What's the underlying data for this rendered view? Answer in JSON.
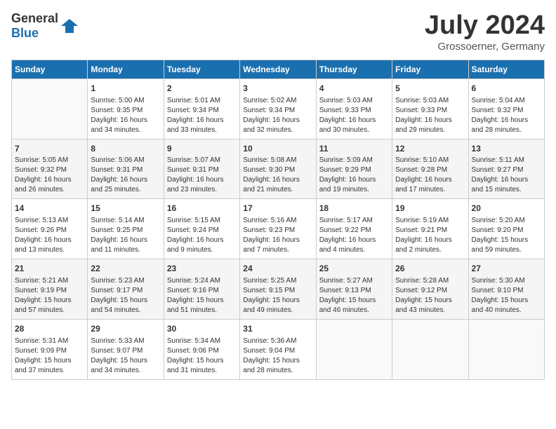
{
  "header": {
    "logo_general": "General",
    "logo_blue": "Blue",
    "month": "July 2024",
    "location": "Grossoerner, Germany"
  },
  "weekdays": [
    "Sunday",
    "Monday",
    "Tuesday",
    "Wednesday",
    "Thursday",
    "Friday",
    "Saturday"
  ],
  "weeks": [
    [
      {
        "day": "",
        "info": ""
      },
      {
        "day": "1",
        "info": "Sunrise: 5:00 AM\nSunset: 9:35 PM\nDaylight: 16 hours\nand 34 minutes."
      },
      {
        "day": "2",
        "info": "Sunrise: 5:01 AM\nSunset: 9:34 PM\nDaylight: 16 hours\nand 33 minutes."
      },
      {
        "day": "3",
        "info": "Sunrise: 5:02 AM\nSunset: 9:34 PM\nDaylight: 16 hours\nand 32 minutes."
      },
      {
        "day": "4",
        "info": "Sunrise: 5:03 AM\nSunset: 9:33 PM\nDaylight: 16 hours\nand 30 minutes."
      },
      {
        "day": "5",
        "info": "Sunrise: 5:03 AM\nSunset: 9:33 PM\nDaylight: 16 hours\nand 29 minutes."
      },
      {
        "day": "6",
        "info": "Sunrise: 5:04 AM\nSunset: 9:32 PM\nDaylight: 16 hours\nand 28 minutes."
      }
    ],
    [
      {
        "day": "7",
        "info": "Sunrise: 5:05 AM\nSunset: 9:32 PM\nDaylight: 16 hours\nand 26 minutes."
      },
      {
        "day": "8",
        "info": "Sunrise: 5:06 AM\nSunset: 9:31 PM\nDaylight: 16 hours\nand 25 minutes."
      },
      {
        "day": "9",
        "info": "Sunrise: 5:07 AM\nSunset: 9:31 PM\nDaylight: 16 hours\nand 23 minutes."
      },
      {
        "day": "10",
        "info": "Sunrise: 5:08 AM\nSunset: 9:30 PM\nDaylight: 16 hours\nand 21 minutes."
      },
      {
        "day": "11",
        "info": "Sunrise: 5:09 AM\nSunset: 9:29 PM\nDaylight: 16 hours\nand 19 minutes."
      },
      {
        "day": "12",
        "info": "Sunrise: 5:10 AM\nSunset: 9:28 PM\nDaylight: 16 hours\nand 17 minutes."
      },
      {
        "day": "13",
        "info": "Sunrise: 5:11 AM\nSunset: 9:27 PM\nDaylight: 16 hours\nand 15 minutes."
      }
    ],
    [
      {
        "day": "14",
        "info": "Sunrise: 5:13 AM\nSunset: 9:26 PM\nDaylight: 16 hours\nand 13 minutes."
      },
      {
        "day": "15",
        "info": "Sunrise: 5:14 AM\nSunset: 9:25 PM\nDaylight: 16 hours\nand 11 minutes."
      },
      {
        "day": "16",
        "info": "Sunrise: 5:15 AM\nSunset: 9:24 PM\nDaylight: 16 hours\nand 9 minutes."
      },
      {
        "day": "17",
        "info": "Sunrise: 5:16 AM\nSunset: 9:23 PM\nDaylight: 16 hours\nand 7 minutes."
      },
      {
        "day": "18",
        "info": "Sunrise: 5:17 AM\nSunset: 9:22 PM\nDaylight: 16 hours\nand 4 minutes."
      },
      {
        "day": "19",
        "info": "Sunrise: 5:19 AM\nSunset: 9:21 PM\nDaylight: 16 hours\nand 2 minutes."
      },
      {
        "day": "20",
        "info": "Sunrise: 5:20 AM\nSunset: 9:20 PM\nDaylight: 15 hours\nand 59 minutes."
      }
    ],
    [
      {
        "day": "21",
        "info": "Sunrise: 5:21 AM\nSunset: 9:19 PM\nDaylight: 15 hours\nand 57 minutes."
      },
      {
        "day": "22",
        "info": "Sunrise: 5:23 AM\nSunset: 9:17 PM\nDaylight: 15 hours\nand 54 minutes."
      },
      {
        "day": "23",
        "info": "Sunrise: 5:24 AM\nSunset: 9:16 PM\nDaylight: 15 hours\nand 51 minutes."
      },
      {
        "day": "24",
        "info": "Sunrise: 5:25 AM\nSunset: 9:15 PM\nDaylight: 15 hours\nand 49 minutes."
      },
      {
        "day": "25",
        "info": "Sunrise: 5:27 AM\nSunset: 9:13 PM\nDaylight: 15 hours\nand 46 minutes."
      },
      {
        "day": "26",
        "info": "Sunrise: 5:28 AM\nSunset: 9:12 PM\nDaylight: 15 hours\nand 43 minutes."
      },
      {
        "day": "27",
        "info": "Sunrise: 5:30 AM\nSunset: 9:10 PM\nDaylight: 15 hours\nand 40 minutes."
      }
    ],
    [
      {
        "day": "28",
        "info": "Sunrise: 5:31 AM\nSunset: 9:09 PM\nDaylight: 15 hours\nand 37 minutes."
      },
      {
        "day": "29",
        "info": "Sunrise: 5:33 AM\nSunset: 9:07 PM\nDaylight: 15 hours\nand 34 minutes."
      },
      {
        "day": "30",
        "info": "Sunrise: 5:34 AM\nSunset: 9:06 PM\nDaylight: 15 hours\nand 31 minutes."
      },
      {
        "day": "31",
        "info": "Sunrise: 5:36 AM\nSunset: 9:04 PM\nDaylight: 15 hours\nand 28 minutes."
      },
      {
        "day": "",
        "info": ""
      },
      {
        "day": "",
        "info": ""
      },
      {
        "day": "",
        "info": ""
      }
    ]
  ]
}
